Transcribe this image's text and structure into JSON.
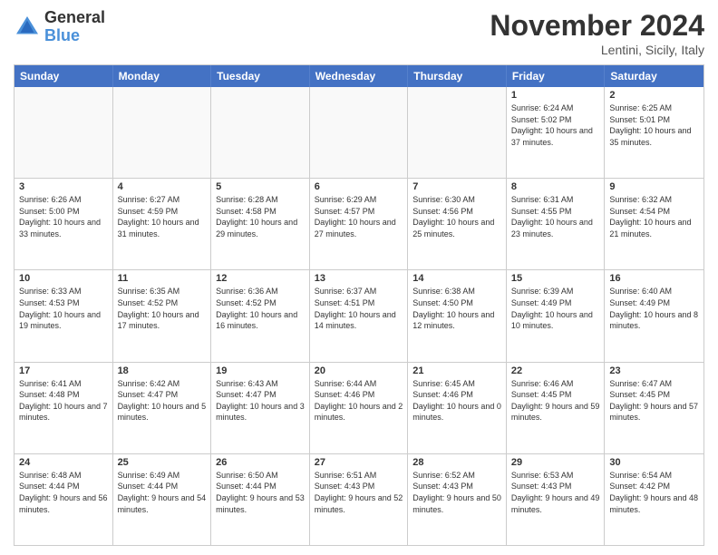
{
  "header": {
    "logo_general": "General",
    "logo_blue": "Blue",
    "title": "November 2024",
    "location": "Lentini, Sicily, Italy"
  },
  "days_of_week": [
    "Sunday",
    "Monday",
    "Tuesday",
    "Wednesday",
    "Thursday",
    "Friday",
    "Saturday"
  ],
  "weeks": [
    [
      {
        "day": "",
        "info": ""
      },
      {
        "day": "",
        "info": ""
      },
      {
        "day": "",
        "info": ""
      },
      {
        "day": "",
        "info": ""
      },
      {
        "day": "",
        "info": ""
      },
      {
        "day": "1",
        "info": "Sunrise: 6:24 AM\nSunset: 5:02 PM\nDaylight: 10 hours\nand 37 minutes."
      },
      {
        "day": "2",
        "info": "Sunrise: 6:25 AM\nSunset: 5:01 PM\nDaylight: 10 hours\nand 35 minutes."
      }
    ],
    [
      {
        "day": "3",
        "info": "Sunrise: 6:26 AM\nSunset: 5:00 PM\nDaylight: 10 hours\nand 33 minutes."
      },
      {
        "day": "4",
        "info": "Sunrise: 6:27 AM\nSunset: 4:59 PM\nDaylight: 10 hours\nand 31 minutes."
      },
      {
        "day": "5",
        "info": "Sunrise: 6:28 AM\nSunset: 4:58 PM\nDaylight: 10 hours\nand 29 minutes."
      },
      {
        "day": "6",
        "info": "Sunrise: 6:29 AM\nSunset: 4:57 PM\nDaylight: 10 hours\nand 27 minutes."
      },
      {
        "day": "7",
        "info": "Sunrise: 6:30 AM\nSunset: 4:56 PM\nDaylight: 10 hours\nand 25 minutes."
      },
      {
        "day": "8",
        "info": "Sunrise: 6:31 AM\nSunset: 4:55 PM\nDaylight: 10 hours\nand 23 minutes."
      },
      {
        "day": "9",
        "info": "Sunrise: 6:32 AM\nSunset: 4:54 PM\nDaylight: 10 hours\nand 21 minutes."
      }
    ],
    [
      {
        "day": "10",
        "info": "Sunrise: 6:33 AM\nSunset: 4:53 PM\nDaylight: 10 hours\nand 19 minutes."
      },
      {
        "day": "11",
        "info": "Sunrise: 6:35 AM\nSunset: 4:52 PM\nDaylight: 10 hours\nand 17 minutes."
      },
      {
        "day": "12",
        "info": "Sunrise: 6:36 AM\nSunset: 4:52 PM\nDaylight: 10 hours\nand 16 minutes."
      },
      {
        "day": "13",
        "info": "Sunrise: 6:37 AM\nSunset: 4:51 PM\nDaylight: 10 hours\nand 14 minutes."
      },
      {
        "day": "14",
        "info": "Sunrise: 6:38 AM\nSunset: 4:50 PM\nDaylight: 10 hours\nand 12 minutes."
      },
      {
        "day": "15",
        "info": "Sunrise: 6:39 AM\nSunset: 4:49 PM\nDaylight: 10 hours\nand 10 minutes."
      },
      {
        "day": "16",
        "info": "Sunrise: 6:40 AM\nSunset: 4:49 PM\nDaylight: 10 hours\nand 8 minutes."
      }
    ],
    [
      {
        "day": "17",
        "info": "Sunrise: 6:41 AM\nSunset: 4:48 PM\nDaylight: 10 hours\nand 7 minutes."
      },
      {
        "day": "18",
        "info": "Sunrise: 6:42 AM\nSunset: 4:47 PM\nDaylight: 10 hours\nand 5 minutes."
      },
      {
        "day": "19",
        "info": "Sunrise: 6:43 AM\nSunset: 4:47 PM\nDaylight: 10 hours\nand 3 minutes."
      },
      {
        "day": "20",
        "info": "Sunrise: 6:44 AM\nSunset: 4:46 PM\nDaylight: 10 hours\nand 2 minutes."
      },
      {
        "day": "21",
        "info": "Sunrise: 6:45 AM\nSunset: 4:46 PM\nDaylight: 10 hours\nand 0 minutes."
      },
      {
        "day": "22",
        "info": "Sunrise: 6:46 AM\nSunset: 4:45 PM\nDaylight: 9 hours\nand 59 minutes."
      },
      {
        "day": "23",
        "info": "Sunrise: 6:47 AM\nSunset: 4:45 PM\nDaylight: 9 hours\nand 57 minutes."
      }
    ],
    [
      {
        "day": "24",
        "info": "Sunrise: 6:48 AM\nSunset: 4:44 PM\nDaylight: 9 hours\nand 56 minutes."
      },
      {
        "day": "25",
        "info": "Sunrise: 6:49 AM\nSunset: 4:44 PM\nDaylight: 9 hours\nand 54 minutes."
      },
      {
        "day": "26",
        "info": "Sunrise: 6:50 AM\nSunset: 4:44 PM\nDaylight: 9 hours\nand 53 minutes."
      },
      {
        "day": "27",
        "info": "Sunrise: 6:51 AM\nSunset: 4:43 PM\nDaylight: 9 hours\nand 52 minutes."
      },
      {
        "day": "28",
        "info": "Sunrise: 6:52 AM\nSunset: 4:43 PM\nDaylight: 9 hours\nand 50 minutes."
      },
      {
        "day": "29",
        "info": "Sunrise: 6:53 AM\nSunset: 4:43 PM\nDaylight: 9 hours\nand 49 minutes."
      },
      {
        "day": "30",
        "info": "Sunrise: 6:54 AM\nSunset: 4:42 PM\nDaylight: 9 hours\nand 48 minutes."
      }
    ]
  ]
}
